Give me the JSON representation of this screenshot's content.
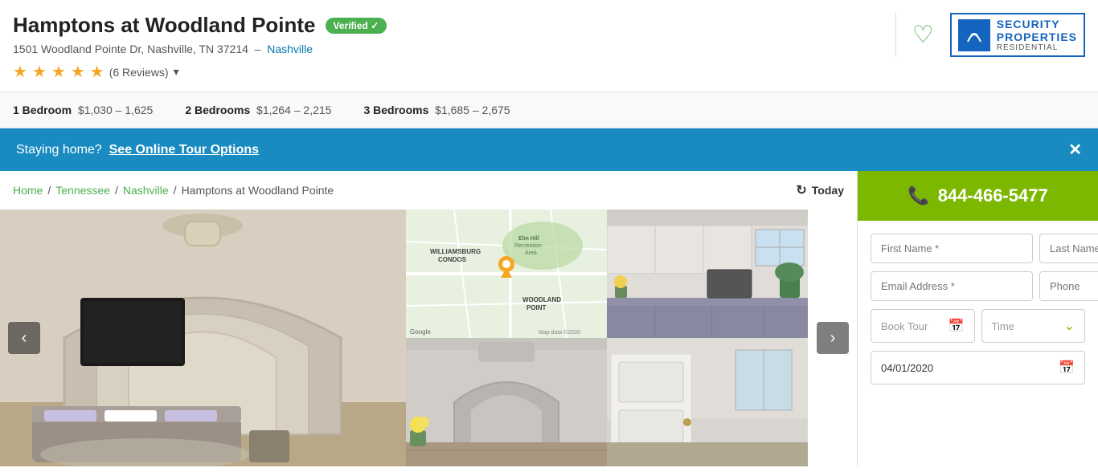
{
  "header": {
    "title": "Hamptons at Woodland Pointe",
    "verified_label": "Verified ✓",
    "address": "1501 Woodland Pointe Dr, Nashville, TN 37214",
    "address_link": "Nashville",
    "stars_count": 5,
    "reviews_label": "(6 Reviews)",
    "chevron": "▾",
    "heart_icon": "♡",
    "logo_icon": "≋",
    "logo_top": "SECURITY",
    "logo_mid": "PROPERTIES",
    "logo_bot": "RESIDENTIAL"
  },
  "pricing": {
    "one_bed_label": "1 Bedroom",
    "one_bed_range": "$1,030 – 1,625",
    "two_bed_label": "2 Bedrooms",
    "two_bed_range": "$1,264 – 2,215",
    "three_bed_label": "3 Bedrooms",
    "three_bed_range": "$1,685 – 2,675"
  },
  "tour_banner": {
    "prefix": "Staying home?",
    "link_text": "See Online Tour Options",
    "close": "✕"
  },
  "breadcrumb": {
    "home": "Home",
    "state": "Tennessee",
    "city": "Nashville",
    "current": "Hamptons at Woodland Pointe",
    "today_label": "Today",
    "refresh_icon": "↻"
  },
  "map": {
    "label_wc": "WILLIAMSBURG\nCONDOS",
    "label_wp": "WOODLAND\nPOINT",
    "google_label": "Google",
    "map_data": "Map data ©2020"
  },
  "sidebar": {
    "phone": "844-466-5477",
    "phone_icon": "📞",
    "first_name_placeholder": "First Name *",
    "last_name_placeholder": "Last Name *",
    "email_placeholder": "Email Address *",
    "phone_placeholder": "Phone",
    "book_tour_label": "Book Tour",
    "time_label": "Time",
    "date_value": "04/01/2020",
    "calendar_icon": "📅",
    "chevron_down": "⌄"
  },
  "colors": {
    "green": "#7cb800",
    "blue": "#1a8bc1",
    "star": "#f5a623"
  }
}
